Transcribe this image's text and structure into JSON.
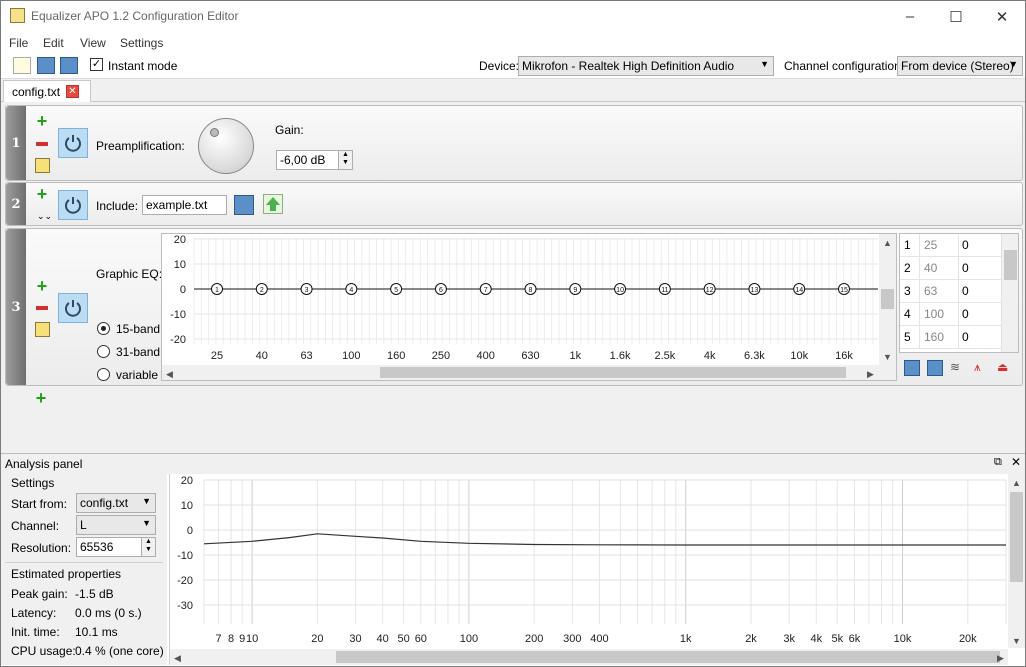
{
  "window": {
    "title": "Equalizer APO 1.2 Configuration Editor",
    "minimize": "–",
    "maximize": "☐",
    "close": "✕"
  },
  "menu": [
    "File",
    "Edit",
    "View",
    "Settings"
  ],
  "toolbar": {
    "instant_mode_label": "Instant mode",
    "instant_mode_checked": true,
    "device_label": "Device:",
    "device_value": "Mikrofon - Realtek High Definition Audio",
    "channel_config_label": "Channel configuration:",
    "channel_config_value": "From device (Stereo)"
  },
  "tabs": [
    {
      "label": "config.txt"
    }
  ],
  "filters": [
    {
      "number": "1",
      "type_label": "Preamplification:",
      "gain_label": "Gain:",
      "gain_value": "-6,00 dB"
    },
    {
      "number": "2",
      "type_label": "Include:",
      "file_value": "example.txt"
    },
    {
      "number": "3",
      "type_label": "Graphic EQ:",
      "modes": [
        "15-band",
        "31-band",
        "variable"
      ],
      "selected_mode": "15-band"
    }
  ],
  "eq": {
    "y_ticks": [
      "20",
      "10",
      "0",
      "-10",
      "-20"
    ],
    "bands": [
      "25",
      "40",
      "63",
      "100",
      "160",
      "250",
      "400",
      "630",
      "1k",
      "1.6k",
      "2.5k",
      "4k",
      "6.3k",
      "10k",
      "16k"
    ],
    "node_labels": [
      "1",
      "2",
      "3",
      "4",
      "5",
      "6",
      "7",
      "8",
      "9",
      "10",
      "11",
      "12",
      "13",
      "14",
      "15"
    ],
    "gains": [
      0,
      0,
      0,
      0,
      0,
      0,
      0,
      0,
      0,
      0,
      0,
      0,
      0,
      0,
      0
    ]
  },
  "eq_table": {
    "rows": [
      {
        "index": "1",
        "freq": "25",
        "gain": "0"
      },
      {
        "index": "2",
        "freq": "40",
        "gain": "0"
      },
      {
        "index": "3",
        "freq": "63",
        "gain": "0"
      },
      {
        "index": "4",
        "freq": "100",
        "gain": "0"
      },
      {
        "index": "5",
        "freq": "160",
        "gain": "0"
      }
    ]
  },
  "analysis": {
    "title": "Analysis panel",
    "settings_label": "Settings",
    "start_from_label": "Start from:",
    "start_from_value": "config.txt",
    "channel_label": "Channel:",
    "channel_value": "L",
    "resolution_label": "Resolution:",
    "resolution_value": "65536",
    "estimated_label": "Estimated properties",
    "peak_gain_label": "Peak gain:",
    "peak_gain_value": "-1.5 dB",
    "latency_label": "Latency:",
    "latency_value": "0.0 ms (0 s.)",
    "init_time_label": "Init. time:",
    "init_time_value": "10.1 ms",
    "cpu_usage_label": "CPU usage:",
    "cpu_usage_value": "0.4 % (one core)"
  },
  "chart_data": {
    "type": "line",
    "x_scale": "log",
    "y_ticks": [
      "20",
      "10",
      "0",
      "-10",
      "-20",
      "-30"
    ],
    "ylim": [
      -35,
      20
    ],
    "xlim": [
      6,
      30000
    ],
    "x_tick_labels": [
      "7",
      "8",
      "9",
      "10",
      "20",
      "30",
      "40",
      "50",
      "60",
      "100",
      "200",
      "300",
      "400",
      "1k",
      "2k",
      "3k",
      "4k",
      "5k",
      "6k",
      "10k",
      "20k"
    ],
    "x_tick_values": [
      7,
      8,
      9,
      10,
      20,
      30,
      40,
      50,
      60,
      100,
      200,
      300,
      400,
      1000,
      2000,
      3000,
      4000,
      5000,
      6000,
      10000,
      20000
    ],
    "x": [
      6,
      10,
      15,
      20,
      30,
      40,
      60,
      100,
      200,
      400,
      1000,
      3000,
      10000,
      30000
    ],
    "y": [
      -5.5,
      -4.5,
      -3,
      -1.5,
      -2.5,
      -3.2,
      -4.5,
      -5.3,
      -5.8,
      -5.9,
      -6,
      -6,
      -6,
      -6
    ],
    "grid": true
  }
}
